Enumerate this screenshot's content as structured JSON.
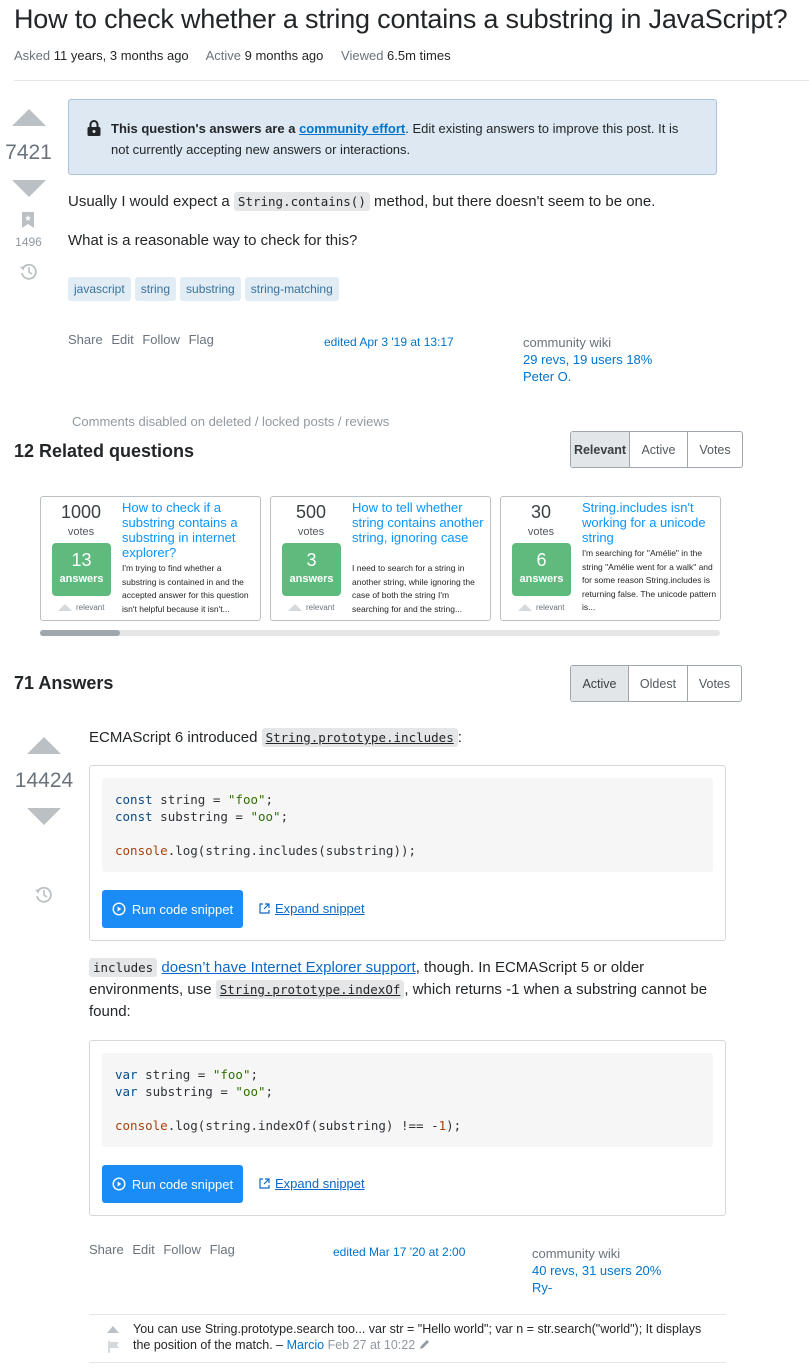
{
  "question": {
    "title": "How to check whether a string contains a substring in JavaScript?",
    "meta": {
      "asked_label": "Asked",
      "asked_value": "11 years, 3 months ago",
      "active_label": "Active",
      "active_value": "9 months ago",
      "viewed_label": "Viewed",
      "viewed_value": "6.5m times"
    },
    "votes": "7421",
    "bookmarks": "1496",
    "notice": {
      "bold_text": "This question's answers are a",
      "link_text": "community effort",
      "rest_text": ". Edit existing answers to improve this post. It is not currently accepting new answers or interactions."
    },
    "body": {
      "line1_before": "Usually I would expect a",
      "line1_code": "String.contains()",
      "line1_after": "method, but there doesn't seem to be one.",
      "line2": "What is a reasonable way to check for this?"
    },
    "tags": [
      "javascript",
      "string",
      "substring",
      "string-matching"
    ],
    "menu": [
      "Share",
      "Edit",
      "Follow",
      "Flag"
    ],
    "edited": "edited Apr 3 '19 at 13:17",
    "signature": {
      "label": "community wiki",
      "revs": "29 revs, 19 users 18%",
      "user": "Peter O."
    },
    "comments_disabled": "Comments disabled on deleted / locked posts / reviews"
  },
  "related": {
    "title": "12 Related questions",
    "sort_options": [
      "Relevant",
      "Active",
      "Votes"
    ],
    "sort_active": "Relevant",
    "cards": [
      {
        "votes": "1000",
        "votes_label": "votes",
        "answers": "13",
        "answers_label": "answers",
        "relevant_label": "relevant",
        "title": "How to check if a substring contains a substring in internet explorer?",
        "excerpt": "I'm trying to find whether a substring is contained in and the accepted answer for this question isn't helpful because it isn't..."
      },
      {
        "votes": "500",
        "votes_label": "votes",
        "answers": "3",
        "answers_label": "answers",
        "relevant_label": "relevant",
        "title": "How to tell whether string contains another string, ignoring case",
        "excerpt": "I need to search for a string in another string, while ignoring the case of both the string I'm searching for and the string..."
      },
      {
        "votes": "30",
        "votes_label": "votes",
        "answers": "6",
        "answers_label": "answers",
        "relevant_label": "relevant",
        "title": "String.includes isn't working for a unicode string",
        "excerpt": "I'm searching for \"Amélie\" in the string \"Amélie went for a walk\" and for some reason String.includes is returning false. The unicode pattern is..."
      }
    ]
  },
  "answers": {
    "title": "71 Answers",
    "sort_options": [
      "Active",
      "Oldest",
      "Votes"
    ],
    "sort_active": "Active",
    "top_answer": {
      "votes": "14424",
      "intro_text": "ECMAScript 6 introduced",
      "intro_code": "String.prototype.includes",
      "intro_after": ":",
      "snippet1": {
        "lines": [
          [
            {
              "t": "kw",
              "v": "const"
            },
            {
              "t": "",
              "v": " string = "
            },
            {
              "t": "str",
              "v": "\"foo\""
            },
            {
              "t": "",
              "v": ";"
            }
          ],
          [
            {
              "t": "kw",
              "v": "const"
            },
            {
              "t": "",
              "v": " substring = "
            },
            {
              "t": "str",
              "v": "\"oo\""
            },
            {
              "t": "",
              "v": ";"
            }
          ],
          [],
          [
            {
              "t": "con",
              "v": "console"
            },
            {
              "t": "",
              "v": ".log(string.includes(substring));"
            }
          ]
        ]
      },
      "run_label": "Run code snippet",
      "expand_label": "Expand snippet",
      "para_code1": "includes",
      "para_link": "doesn’t have Internet Explorer support",
      "para_text1": ", though. In ECMAScript 5 or older environments, use",
      "para_code2": "String.prototype.indexOf",
      "para_text2": ", which returns -1 when a substring cannot be found:",
      "snippet2": {
        "lines": [
          [
            {
              "t": "kw",
              "v": "var"
            },
            {
              "t": "",
              "v": " string = "
            },
            {
              "t": "str",
              "v": "\"foo\""
            },
            {
              "t": "",
              "v": ";"
            }
          ],
          [
            {
              "t": "kw",
              "v": "var"
            },
            {
              "t": "",
              "v": " substring = "
            },
            {
              "t": "str",
              "v": "\"oo\""
            },
            {
              "t": "",
              "v": ";"
            }
          ],
          [],
          [
            {
              "t": "con",
              "v": "console"
            },
            {
              "t": "",
              "v": ".log(string.indexOf(substring) !== -"
            },
            {
              "t": "num",
              "v": "1"
            },
            {
              "t": "",
              "v": ");"
            }
          ]
        ]
      },
      "menu": [
        "Share",
        "Edit",
        "Follow",
        "Flag"
      ],
      "edited": "edited Mar 17 '20 at 2:00",
      "signature": {
        "label": "community wiki",
        "revs": "40 revs, 31 users 20%",
        "user": "Ry-"
      },
      "comment": {
        "text": "You can use String.prototype.search too... var str = \"Hello world\"; var n = str.search(\"world\"); It displays the position of the match. –",
        "user": "Marcio",
        "timestamp": "Feb 27 at 10:22"
      }
    }
  }
}
